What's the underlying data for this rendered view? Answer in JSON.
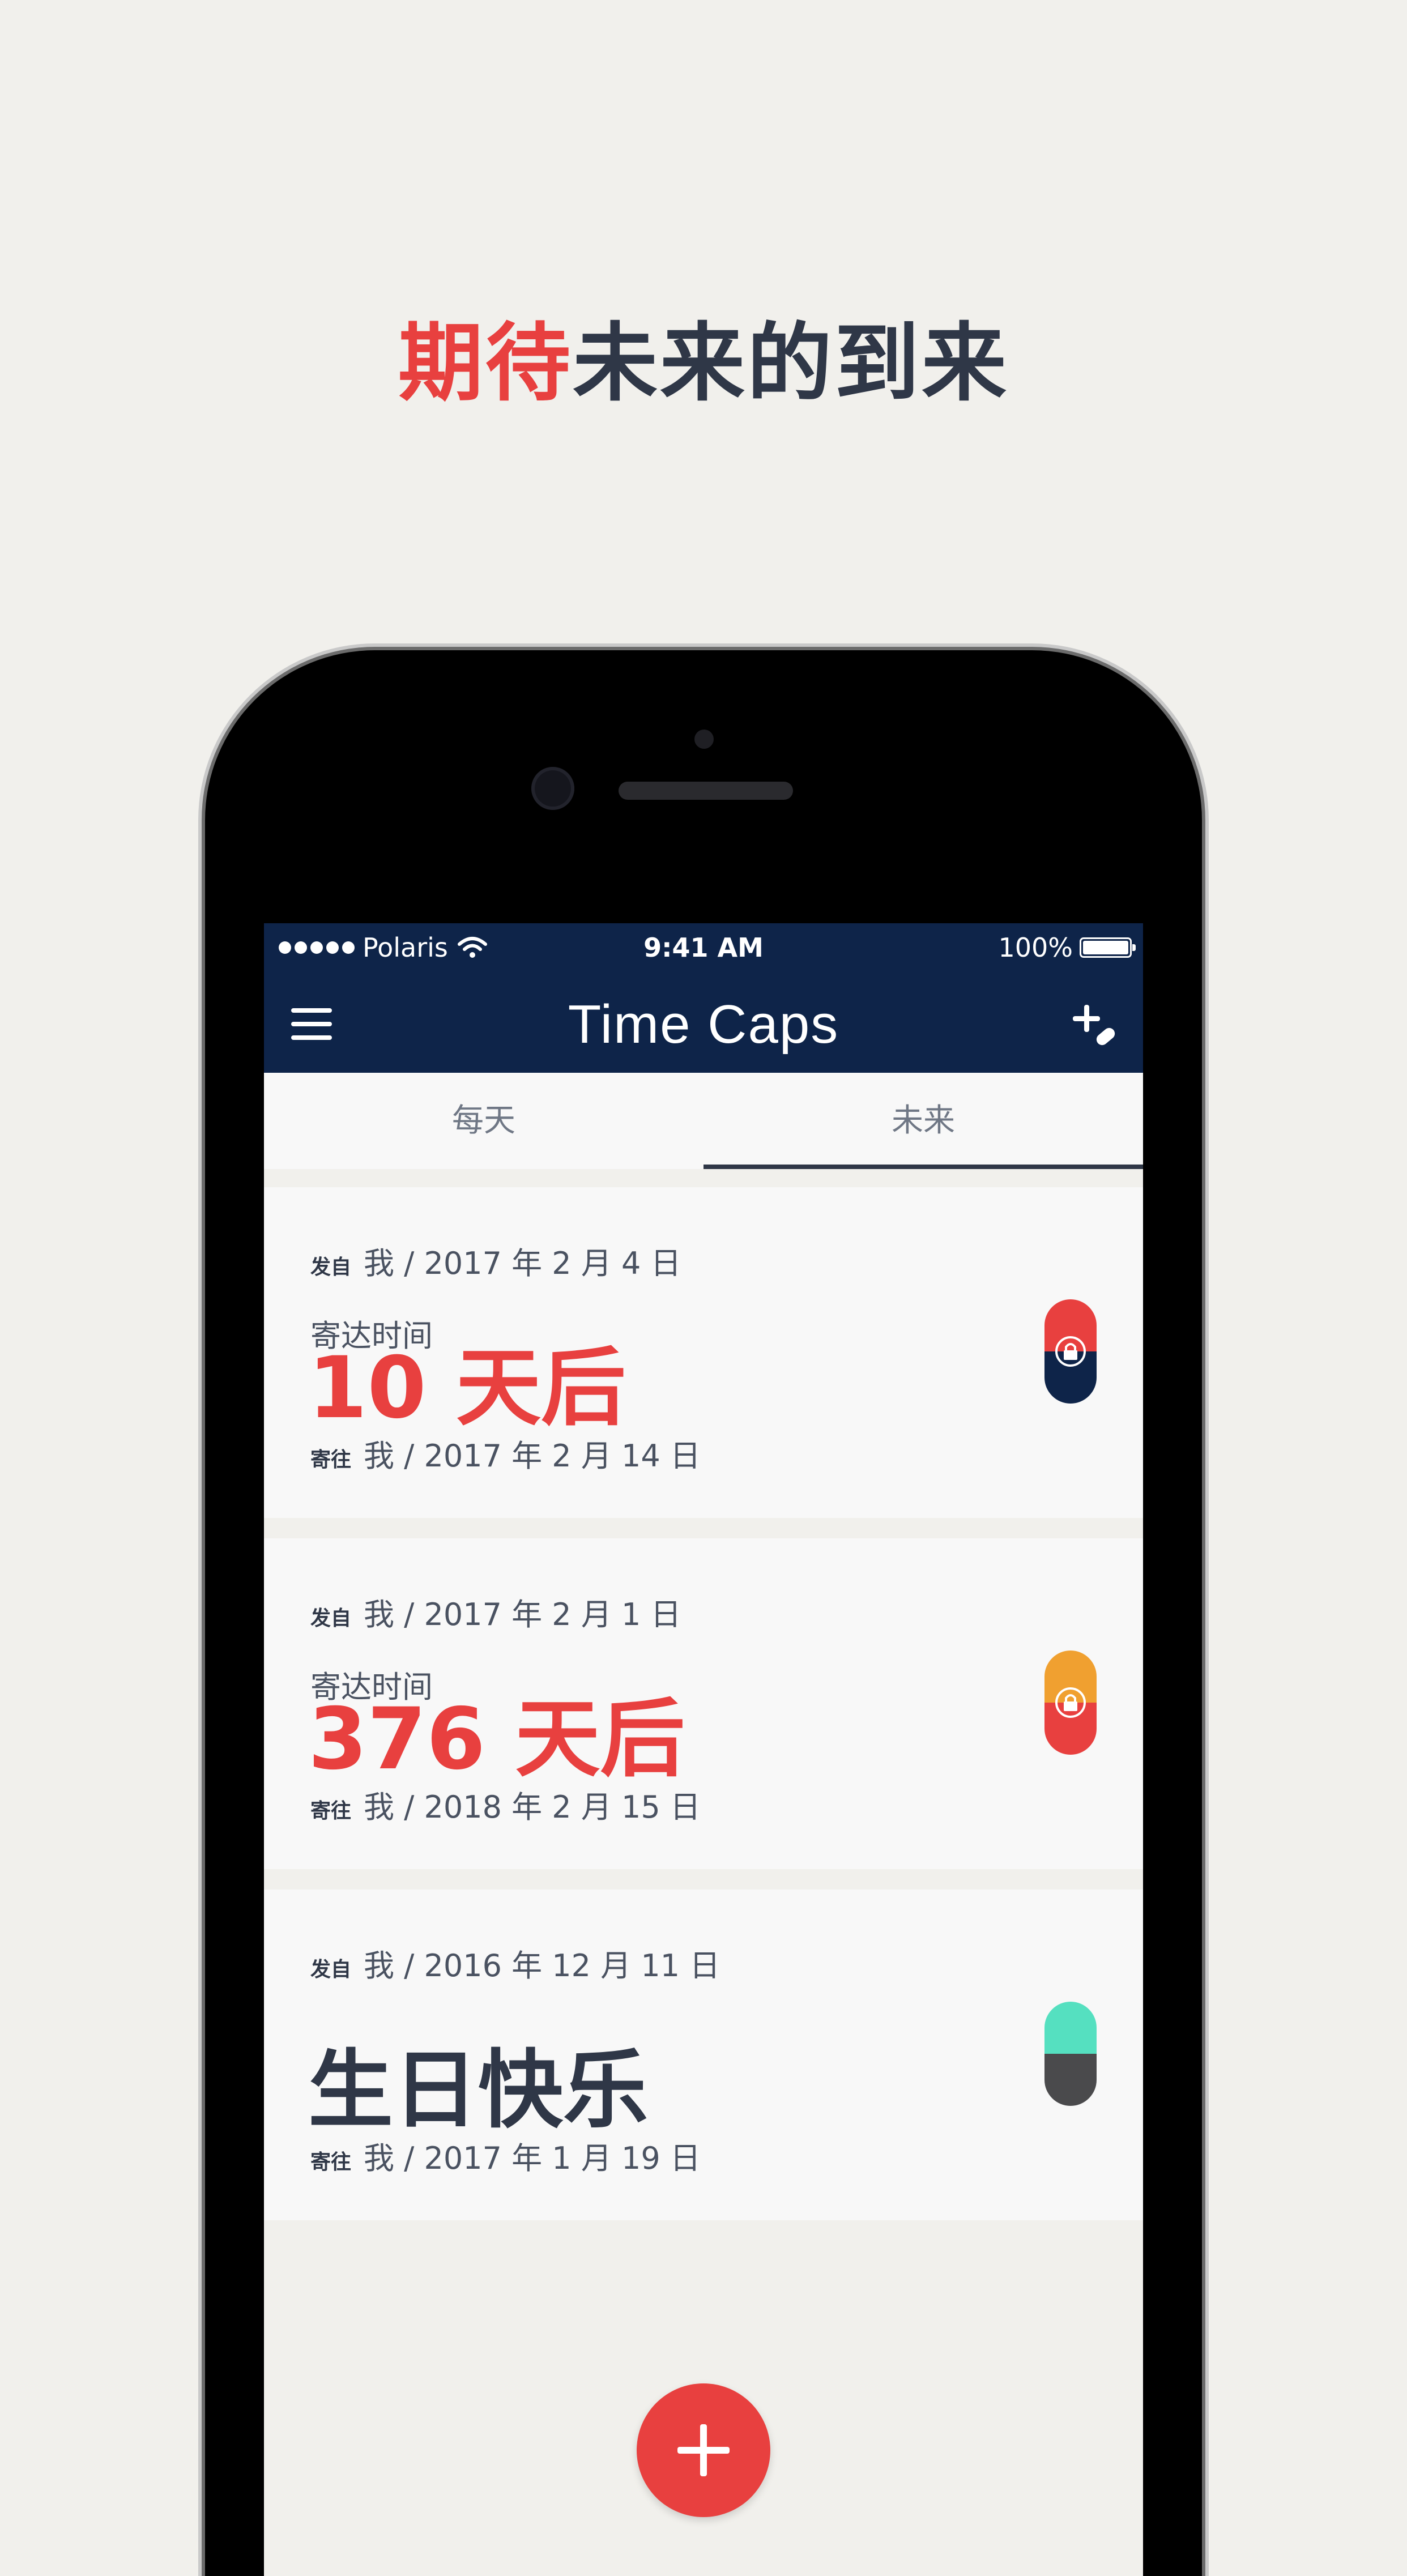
{
  "headline": {
    "accent": "期待",
    "rest": "未来的到来"
  },
  "status_bar": {
    "carrier": "Polaris",
    "time": "9:41 AM",
    "battery": "100%"
  },
  "navbar": {
    "title": "Time Caps"
  },
  "tabs": [
    {
      "label": "每天"
    },
    {
      "label": "未来"
    }
  ],
  "active_tab": "未来",
  "cards": [
    {
      "from_tag": "发自",
      "from": "我 / 2017 年 2 月 4 日",
      "arrival_label": "寄达时间",
      "headline": "10 天后",
      "to_tag": "寄往",
      "to": "我 / 2017 年 2 月 14 日",
      "capsule": {
        "top_color": "#e8403f",
        "bottom_color": "#0e2449",
        "locked": true
      }
    },
    {
      "from_tag": "发自",
      "from": "我 / 2017 年 2 月 1 日",
      "arrival_label": "寄达时间",
      "headline": "376 天后",
      "to_tag": "寄往",
      "to": "我 / 2018 年 2 月 15 日",
      "capsule": {
        "top_color": "#f0a030",
        "bottom_color": "#e8403f",
        "locked": true
      }
    },
    {
      "from_tag": "发自",
      "from": "我 / 2016 年 12 月 11 日",
      "arrival_label": "",
      "headline": "生日快乐",
      "to_tag": "寄往",
      "to": "我 / 2017 年 1 月 19 日",
      "capsule": {
        "top_color": "#55e0c0",
        "bottom_color": "#4a4a4c",
        "locked": false
      }
    }
  ]
}
